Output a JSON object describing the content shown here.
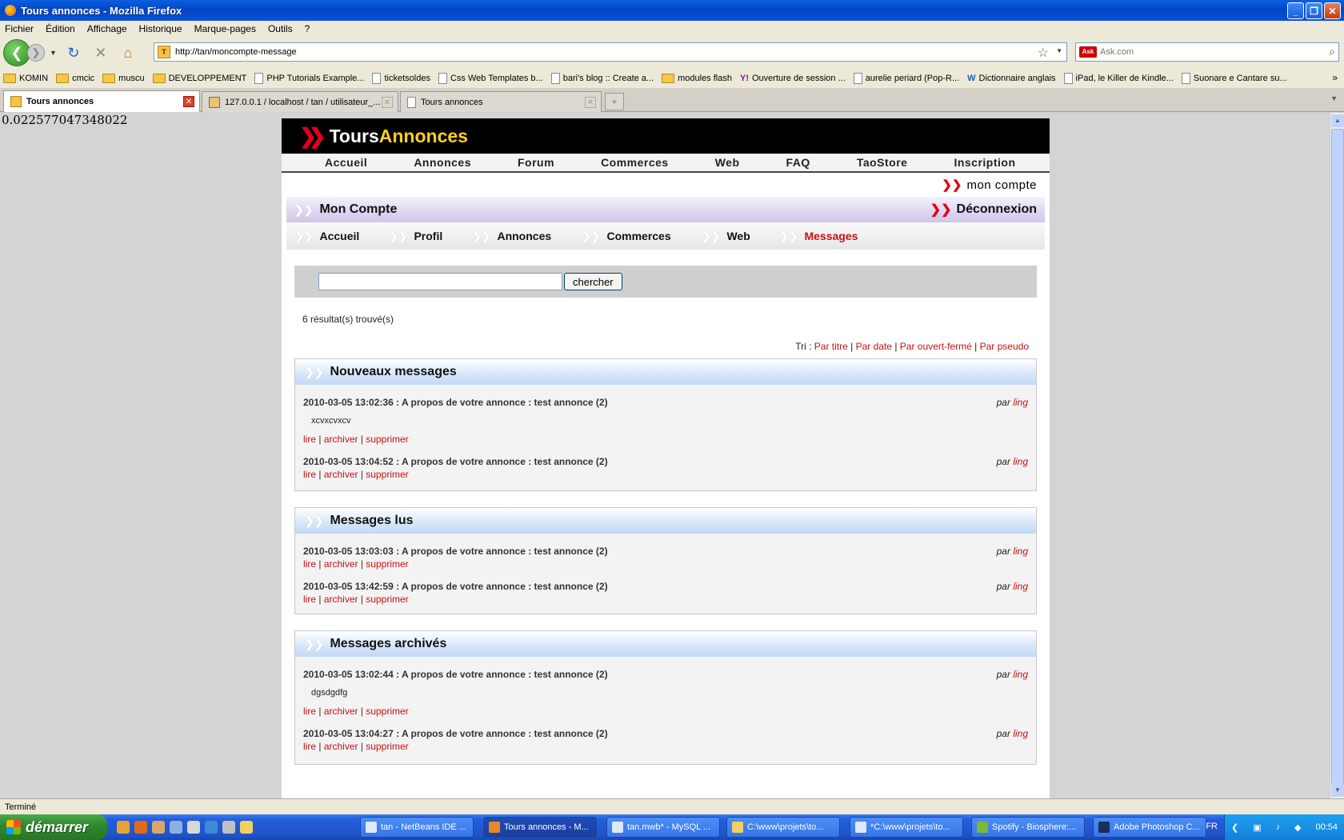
{
  "window": {
    "title": "Tours annonces - Mozilla Firefox"
  },
  "menu": [
    "Fichier",
    "Édition",
    "Affichage",
    "Historique",
    "Marque-pages",
    "Outils",
    "?"
  ],
  "address": {
    "url": "http://tan/moncompte-message",
    "search_placeholder": "Ask.com"
  },
  "bookmarks": [
    {
      "label": "KOMIN",
      "icon": "folder-icon"
    },
    {
      "label": "cmcic",
      "icon": "folder-icon"
    },
    {
      "label": "muscu",
      "icon": "folder-icon"
    },
    {
      "label": "DEVELOPPEMENT",
      "icon": "folder-icon"
    },
    {
      "label": "PHP Tutorials Example...",
      "icon": "page-icon"
    },
    {
      "label": "ticketsoldes",
      "icon": "page-icon"
    },
    {
      "label": "Css Web Templates b...",
      "icon": "page-icon"
    },
    {
      "label": "bari's blog :: Create a...",
      "icon": "page-icon"
    },
    {
      "label": "modules flash",
      "icon": "folder-icon"
    },
    {
      "label": "Ouverture de session ...",
      "icon": "yahoo-icon"
    },
    {
      "label": "aurelie periard (Pop-R...",
      "icon": "page-icon"
    },
    {
      "label": "Dictionnaire anglais",
      "icon": "wr-icon"
    },
    {
      "label": "iPad, le Killer de Kindle...",
      "icon": "page-icon"
    },
    {
      "label": "Suonare e Cantare su...",
      "icon": "page-icon"
    }
  ],
  "tabs": [
    {
      "label": "Tours annonces"
    },
    {
      "label": "127.0.0.1 / localhost / tan / utilisateur_..."
    },
    {
      "label": "Tours annonces"
    }
  ],
  "debug_number": "0.022577047348022",
  "site": {
    "logo_tours": "Tours",
    "logo_annonces": "Annonces",
    "topnav": [
      "Accueil",
      "Annonces",
      "Forum",
      "Commerces",
      "Web",
      "FAQ",
      "TaoStore",
      "Inscription"
    ],
    "moncompte": "mon compte",
    "account_title": "Mon Compte",
    "logout": "Déconnexion",
    "subnav": [
      "Accueil",
      "Profil",
      "Annonces",
      "Commerces",
      "Web",
      "Messages"
    ],
    "search_button": "chercher",
    "result_count": "6 résultat(s) trouvé(s)",
    "sort": {
      "prefix": "Tri :",
      "options": [
        "Par titre",
        "Par date",
        "Par ouvert-fermé",
        "Par pseudo"
      ]
    },
    "actions": {
      "read": "lire",
      "archive": "archiver",
      "delete": "supprimer"
    },
    "by_prefix": "par",
    "sections": [
      {
        "title": "Nouveaux messages",
        "messages": [
          {
            "header": "2010-03-05 13:02:36 : A propos de votre annonce : test annonce (2)",
            "author": "ling",
            "body": "xcvxcvxcv"
          },
          {
            "header": "2010-03-05 13:04:52 : A propos de votre annonce : test annonce (2)",
            "author": "ling",
            "body": ""
          }
        ]
      },
      {
        "title": "Messages lus",
        "messages": [
          {
            "header": "2010-03-05 13:03:03 : A propos de votre annonce : test annonce (2)",
            "author": "ling",
            "body": ""
          },
          {
            "header": "2010-03-05 13:42:59 : A propos de votre annonce : test annonce (2)",
            "author": "ling",
            "body": ""
          }
        ]
      },
      {
        "title": "Messages archivés",
        "messages": [
          {
            "header": "2010-03-05 13:02:44 : A propos de votre annonce : test annonce (2)",
            "author": "ling",
            "body": "dgsdgdfg"
          },
          {
            "header": "2010-03-05 13:04:27 : A propos de votre annonce : test annonce (2)",
            "author": "ling",
            "body": ""
          }
        ]
      }
    ]
  },
  "status": "Terminé",
  "taskbar": {
    "start": "démarrer",
    "tasks": [
      "tan - NetBeans IDE ...",
      "Tours annonces - M...",
      "tan.mwb* - MySQL ...",
      "C:\\www\\projets\\to...",
      "*C:\\www\\projets\\to...",
      "Spotify - Biosphere:...",
      "Adobe Photoshop C..."
    ],
    "lang": "FR",
    "clock": "00:54"
  },
  "colors": {
    "accent_red": "#c81010",
    "logo_yellow": "#ffd11a",
    "xp_blue": "#245edb"
  }
}
